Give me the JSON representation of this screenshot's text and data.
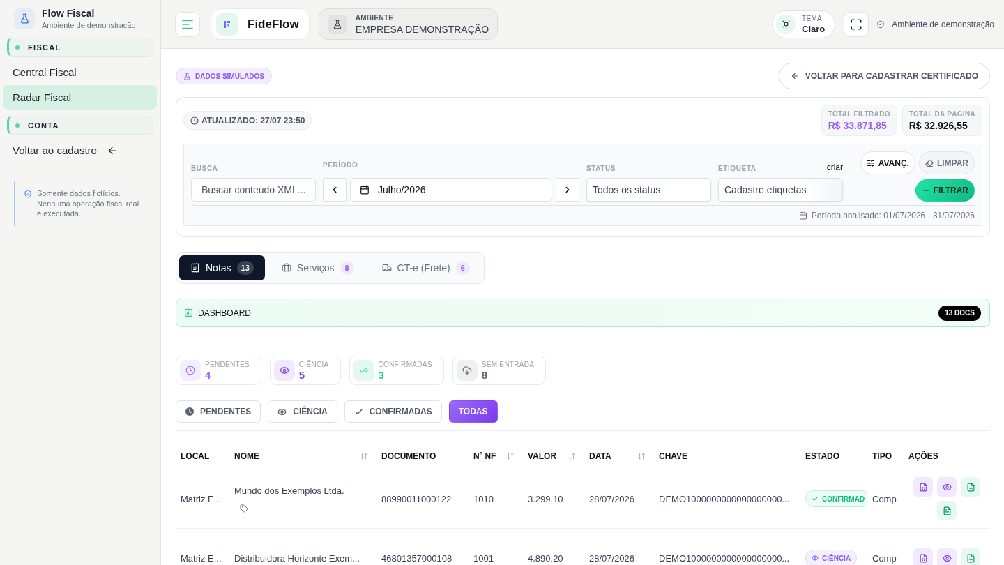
{
  "sidebar": {
    "brand": {
      "title": "Flow Fiscal",
      "subtitle": "Ambiente de demonstração"
    },
    "sections": [
      {
        "title": "FISCAL",
        "items": [
          {
            "label": "Central Fiscal",
            "kind": "page",
            "selected": false
          },
          {
            "label": "Radar Fiscal",
            "kind": "page",
            "selected": true
          }
        ]
      },
      {
        "title": "CONTA",
        "items": [
          {
            "label": "Voltar ao cadastro",
            "kind": "back",
            "selected": false
          }
        ]
      }
    ],
    "notice": "Somente dados fictícios. Nenhuma operação fiscal real é executada."
  },
  "topbar": {
    "brand": "FideFlow",
    "environment": {
      "label": "AMBIENTE",
      "value": "EMPRESA DEMONSTRAÇÃO"
    },
    "theme": {
      "label": "TEMA",
      "value": "Claro"
    },
    "notice": "Ambiente de demonstração"
  },
  "header": {
    "badge": "DADOS SIMULADOS",
    "back_button": "VOLTAR PARA CADASTRAR CERTIFICADO"
  },
  "summary": {
    "updated": "ATUALIZADO: 27/07 23:50",
    "totals": [
      {
        "label": "TOTAL FILTRADO",
        "value": "R$ 33.871,85",
        "color": "#9b5cf0"
      },
      {
        "label": "TOTAL DA PÁGINA",
        "value": "R$ 32.926,55",
        "color": "#111111"
      }
    ]
  },
  "filters": {
    "search": {
      "label": "BUSCA",
      "placeholder": "Buscar conteúdo XML..."
    },
    "period": {
      "label": "PERÍODO",
      "value": "Julho/2026"
    },
    "status": {
      "label": "STATUS",
      "value": "Todos os status"
    },
    "tag": {
      "label": "ETIQUETA",
      "link": "criar",
      "value": "Cadastre etiquetas"
    },
    "buttons": [
      {
        "label": "AVANÇ.",
        "kind": "advanced"
      },
      {
        "label": "LIMPAR",
        "kind": "clear"
      },
      {
        "label": "FILTRAR",
        "kind": "apply"
      }
    ],
    "period_note": "Período analisado: 01/07/2026 - 31/07/2026"
  },
  "doc_tabs": [
    {
      "label": "Notas",
      "count": "13",
      "kind": "notes",
      "selected": true
    },
    {
      "label": "Serviços",
      "count": "8",
      "kind": "services",
      "selected": false
    },
    {
      "label": "CT-e (Frete)",
      "count": "6",
      "kind": "freight",
      "selected": false
    }
  ],
  "dashboard": {
    "title": "DASHBOARD",
    "badge": "13 DOCS"
  },
  "stats": [
    {
      "label": "PENDENTES",
      "value": "4",
      "kind": "pending",
      "color": "#a56ef2"
    },
    {
      "label": "CIÊNCIA",
      "value": "5",
      "kind": "aware",
      "color": "#7c3aed"
    },
    {
      "label": "CONFIRMADAS",
      "value": "3",
      "kind": "confirmed",
      "color": "#2fd39a"
    },
    {
      "label": "SEM ENTRADA",
      "value": "8",
      "kind": "missing",
      "color": "#5b6473"
    }
  ],
  "status_filters": [
    {
      "label": "PENDENTES",
      "kind": "pending",
      "selected": false
    },
    {
      "label": "CIÊNCIA",
      "kind": "aware",
      "selected": false
    },
    {
      "label": "CONFIRMADAS",
      "kind": "confirmed",
      "selected": false
    },
    {
      "label": "TODAS",
      "kind": "all",
      "selected": true
    }
  ],
  "table": {
    "columns": [
      {
        "label": "LOCAL",
        "sortable": false
      },
      {
        "label": "NOME",
        "sortable": true
      },
      {
        "label": "DOCUMENTO",
        "sortable": false
      },
      {
        "label": "Nº NF",
        "sortable": true
      },
      {
        "label": "VALOR",
        "sortable": true
      },
      {
        "label": "DATA",
        "sortable": true
      },
      {
        "label": "CHAVE",
        "sortable": false
      },
      {
        "label": "ESTADO",
        "sortable": false
      },
      {
        "label": "TIPO",
        "sortable": false
      },
      {
        "label": "AÇÕES",
        "sortable": false
      }
    ],
    "rows": [
      {
        "local": "Matriz E...",
        "name": "Mundo dos Exemplos Ltda.",
        "tag_button": true,
        "document": "88990011000122",
        "number": "1010",
        "value": "3.299,10",
        "date": "28/07/2026",
        "key": "DEMO1000000000000000000...",
        "status": {
          "label": "CONFIRMAD",
          "kind": "confirmed"
        },
        "type": "Comp",
        "actions": [
          {
            "kind": "document"
          },
          {
            "kind": "view"
          },
          {
            "kind": "import"
          },
          {
            "kind": "file"
          }
        ]
      },
      {
        "local": "Matriz E...",
        "name": "Distribuidora Horizonte Exem...",
        "document": "46801357000108",
        "number": "1001",
        "value": "4.890,20",
        "date": "28/07/2026",
        "key": "DEMO1000000000000000000...",
        "status": {
          "label": "CIÊNCIA",
          "kind": "aware"
        },
        "type": "Comp",
        "actions": [
          {
            "kind": "document"
          },
          {
            "kind": "view"
          },
          {
            "kind": "import"
          }
        ]
      }
    ]
  }
}
